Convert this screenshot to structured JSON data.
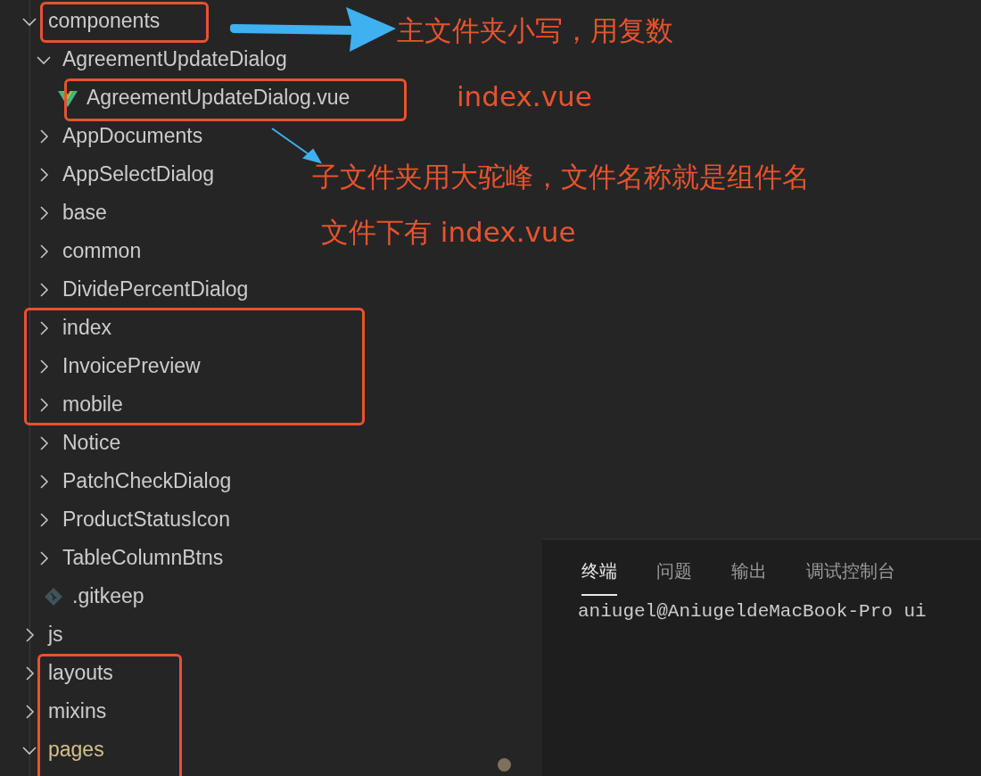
{
  "explorer": {
    "tree": [
      {
        "name": "components",
        "kind": "folder",
        "expanded": true,
        "modified": false,
        "children": [
          {
            "name": "AgreementUpdateDialog",
            "kind": "folder",
            "expanded": true,
            "children": [
              {
                "name": "AgreementUpdateDialog.vue",
                "kind": "vue-file"
              }
            ]
          },
          {
            "name": "AppDocuments",
            "kind": "folder",
            "expanded": false
          },
          {
            "name": "AppSelectDialog",
            "kind": "folder",
            "expanded": false
          },
          {
            "name": "base",
            "kind": "folder",
            "expanded": false
          },
          {
            "name": "common",
            "kind": "folder",
            "expanded": false
          },
          {
            "name": "DividePercentDialog",
            "kind": "folder",
            "expanded": false
          },
          {
            "name": "index",
            "kind": "folder",
            "expanded": false
          },
          {
            "name": "InvoicePreview",
            "kind": "folder",
            "expanded": false
          },
          {
            "name": "mobile",
            "kind": "folder",
            "expanded": false
          },
          {
            "name": "Notice",
            "kind": "folder",
            "expanded": false
          },
          {
            "name": "PatchCheckDialog",
            "kind": "folder",
            "expanded": false
          },
          {
            "name": "ProductStatusIcon",
            "kind": "folder",
            "expanded": false
          },
          {
            "name": "TableColumnBtns",
            "kind": "folder",
            "expanded": false
          },
          {
            "name": ".gitkeep",
            "kind": "git-file"
          }
        ]
      },
      {
        "name": "js",
        "kind": "folder",
        "expanded": false,
        "modified": false
      },
      {
        "name": "layouts",
        "kind": "folder",
        "expanded": false,
        "modified": false
      },
      {
        "name": "mixins",
        "kind": "folder",
        "expanded": false,
        "modified": false
      },
      {
        "name": "pages",
        "kind": "folder",
        "expanded": true,
        "modified": true
      }
    ]
  },
  "panel": {
    "tabs": [
      {
        "label": "终端",
        "selected": true
      },
      {
        "label": "问题",
        "selected": false
      },
      {
        "label": "输出",
        "selected": false
      },
      {
        "label": "调试控制台",
        "selected": false
      }
    ],
    "terminal_line": "aniugel@AniugeldeMacBook-Pro ui"
  },
  "annotations": [
    {
      "text": "主文件夹小写，用复数"
    },
    {
      "text": "index.vue"
    },
    {
      "text": "子文件夹用大驼峰，文件名称就是组件名"
    },
    {
      "text": "文件下有 index.vue"
    }
  ]
}
